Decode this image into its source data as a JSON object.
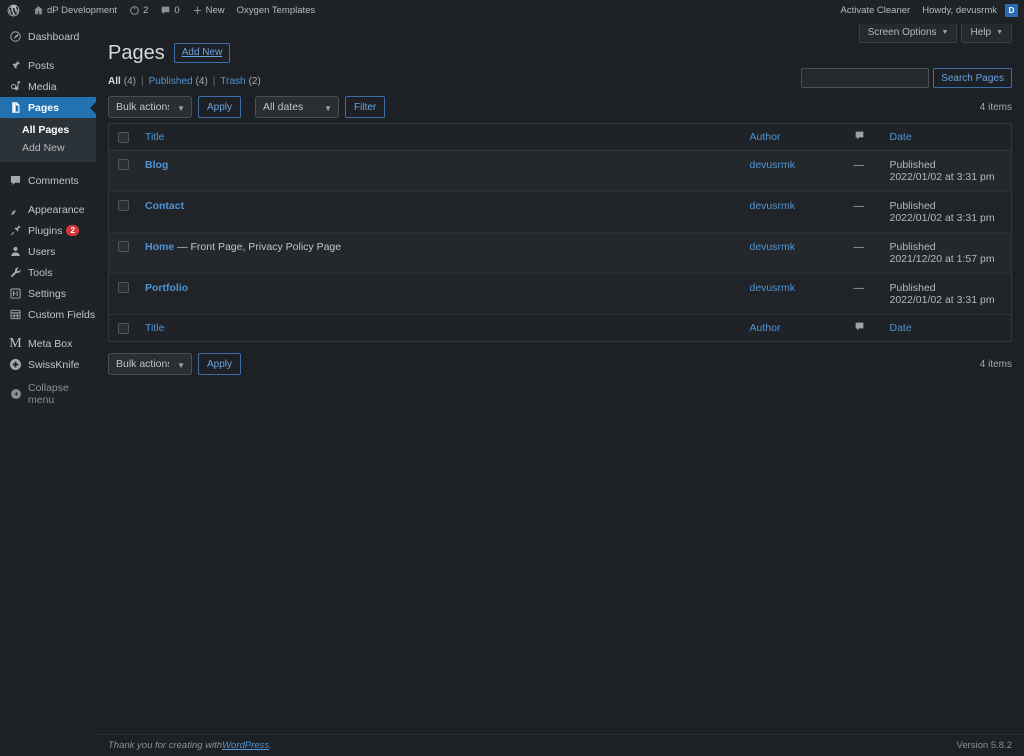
{
  "adminbar": {
    "logo_icon": "wordpress-logo-icon",
    "site_name": "dP Development",
    "site_icon": "home-icon",
    "updates": {
      "icon": "updates-icon",
      "count": "2"
    },
    "comments": {
      "icon": "comment-bubble-icon",
      "count": "0"
    },
    "new": {
      "icon": "plus-icon",
      "label": "New"
    },
    "oxygen": "Oxygen Templates",
    "activate_cleaner": "Activate Cleaner",
    "howdy": "Howdy, devusrmk",
    "avatar_letter": "D"
  },
  "sidebar": {
    "items": [
      {
        "label": "Dashboard",
        "icon": "dashboard-icon",
        "current": false,
        "sep_after": true
      },
      {
        "label": "Posts",
        "icon": "pin-icon",
        "current": false
      },
      {
        "label": "Media",
        "icon": "media-icon",
        "current": false
      },
      {
        "label": "Pages",
        "icon": "page-icon",
        "current": true
      },
      {
        "label": "Comments",
        "icon": "comment-bubble-icon",
        "current": false,
        "sep_before": true
      },
      {
        "label": "Appearance",
        "icon": "brush-icon",
        "current": false,
        "sep_before": true
      },
      {
        "label": "Plugins",
        "icon": "plugin-icon",
        "current": false,
        "badge": "2"
      },
      {
        "label": "Users",
        "icon": "users-icon",
        "current": false
      },
      {
        "label": "Tools",
        "icon": "wrench-icon",
        "current": false
      },
      {
        "label": "Settings",
        "icon": "settings-icon",
        "current": false
      },
      {
        "label": "Custom Fields",
        "icon": "custom-fields-icon",
        "current": false
      },
      {
        "label": "Meta Box",
        "icon": "metabox-m-icon",
        "current": false,
        "sep_before": true
      },
      {
        "label": "SwissKnife",
        "icon": "swissknife-plus-icon",
        "current": false
      }
    ],
    "submenu": [
      {
        "label": "All Pages",
        "current": true
      },
      {
        "label": "Add New",
        "current": false
      }
    ],
    "collapse": {
      "label": "Collapse menu",
      "icon": "collapse-arrow-icon"
    }
  },
  "screen_meta": {
    "screen_options": "Screen Options",
    "help": "Help",
    "caret": "▼"
  },
  "page": {
    "title": "Pages",
    "add_new": "Add New"
  },
  "search": {
    "value": "",
    "placeholder": "",
    "submit_label": "Search Pages"
  },
  "views": [
    {
      "label": "All",
      "count": "(4)",
      "current": true
    },
    {
      "label": "Published",
      "count": "(4)",
      "current": false
    },
    {
      "label": "Trash",
      "count": "(2)",
      "current": false
    }
  ],
  "views_separator": "|",
  "tablenav_top": {
    "bulk_actions": "Bulk actions",
    "apply": "Apply",
    "all_dates": "All dates",
    "filter": "Filter",
    "displaying_num": "4 items"
  },
  "tablenav_bottom": {
    "bulk_actions": "Bulk actions",
    "apply": "Apply",
    "displaying_num": "4 items"
  },
  "table": {
    "columns": {
      "title": "Title",
      "author": "Author",
      "comments_icon": "comment-bubble-icon",
      "date": "Date"
    },
    "rows": [
      {
        "title": "Blog",
        "states": "",
        "author": "devusrmk",
        "comments": "—",
        "date_status": "Published",
        "date_value": "2022/01/02 at 3:31 pm"
      },
      {
        "title": "Contact",
        "states": "",
        "author": "devusrmk",
        "comments": "—",
        "date_status": "Published",
        "date_value": "2022/01/02 at 3:31 pm"
      },
      {
        "title": "Home",
        "states": " — Front Page, Privacy Policy Page",
        "author": "devusrmk",
        "comments": "—",
        "date_status": "Published",
        "date_value": "2021/12/20 at 1:57 pm"
      },
      {
        "title": "Portfolio",
        "states": "",
        "author": "devusrmk",
        "comments": "—",
        "date_status": "Published",
        "date_value": "2022/01/02 at 3:31 pm"
      }
    ]
  },
  "footer": {
    "thanks_prefix": "Thank you for creating with ",
    "wordpress_link": "WordPress",
    "thanks_suffix": ".",
    "version": "Version 5.8.2"
  },
  "colors": {
    "accent": "#2271b1",
    "link": "#4f94d4",
    "sidebar_bg": "#1d2327",
    "content_bg": "#1d2125",
    "badge_red": "#d63638"
  }
}
